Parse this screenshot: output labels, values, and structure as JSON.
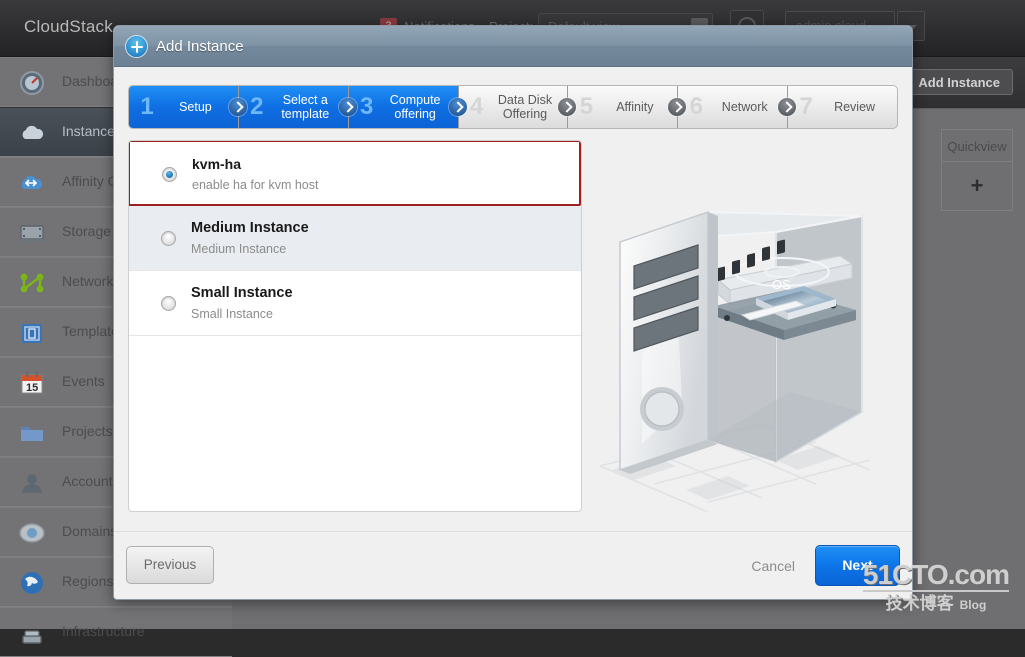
{
  "app": {
    "brand": "CloudStack",
    "header": {
      "notification_count": "3",
      "notifications_label": "Notifications",
      "project_label": "Project:",
      "project_value": "Default view",
      "dashboard_icon": "gauge-icon",
      "user_label": "admin cloud",
      "user_caret_icon": "chevron-down-icon"
    },
    "sidebar": {
      "items": [
        {
          "label": "Dashboard",
          "icon": "dashboard-gauge-icon",
          "active": false
        },
        {
          "label": "Instances",
          "icon": "cloud-icon",
          "active": true
        },
        {
          "label": "Affinity Groups",
          "icon": "affinity-cloud-icon",
          "active": false
        },
        {
          "label": "Storage",
          "icon": "storage-drive-icon",
          "active": false
        },
        {
          "label": "Network",
          "icon": "network-nodes-icon",
          "active": false
        },
        {
          "label": "Templates",
          "icon": "templates-icon",
          "active": false
        },
        {
          "label": "Events",
          "icon": "calendar-icon",
          "active": false
        },
        {
          "label": "Projects",
          "icon": "folder-icon",
          "active": false
        },
        {
          "label": "Accounts",
          "icon": "user-icon",
          "active": false
        },
        {
          "label": "Domains",
          "icon": "domain-icon",
          "active": false
        },
        {
          "label": "Regions",
          "icon": "globe-icon",
          "active": false
        },
        {
          "label": "Infrastructure",
          "icon": "infrastructure-icon",
          "active": false
        }
      ]
    },
    "toolbar": {
      "add_instance_label": "Add Instance",
      "add_instance_icon": "plus-icon"
    },
    "table": {
      "quickview_header": "Quickview",
      "quickview_cell": "+"
    }
  },
  "modal": {
    "title": "Add Instance",
    "title_icon": "plus-circle-icon",
    "steps": [
      {
        "num": "1",
        "label": "Setup",
        "state": "done"
      },
      {
        "num": "2",
        "label": "Select a template",
        "state": "done"
      },
      {
        "num": "3",
        "label": "Compute offering",
        "state": "current"
      },
      {
        "num": "4",
        "label": "Data Disk Offering",
        "state": "pending"
      },
      {
        "num": "5",
        "label": "Affinity",
        "state": "pending"
      },
      {
        "num": "6",
        "label": "Network",
        "state": "pending"
      },
      {
        "num": "7",
        "label": "Review",
        "state": "pending"
      }
    ],
    "offerings": [
      {
        "name": "kvm-ha",
        "desc": "enable ha for kvm host",
        "selected": true,
        "alt": false
      },
      {
        "name": "Medium Instance",
        "desc": "Medium Instance",
        "selected": false,
        "alt": true
      },
      {
        "name": "Small Instance",
        "desc": "Small Instance",
        "selected": false,
        "alt": false
      }
    ],
    "illustration": {
      "name": "computer-tower-illustration",
      "os_label": "OS"
    },
    "footer": {
      "previous_label": "Previous",
      "cancel_label": "Cancel",
      "next_label": "Next"
    },
    "accent_color": "#0d75e8",
    "selected_outline_color": "#9d1f1f"
  },
  "watermark": {
    "main": "51CTO.com",
    "sub": "技术博客",
    "sub_small": "Blog"
  }
}
